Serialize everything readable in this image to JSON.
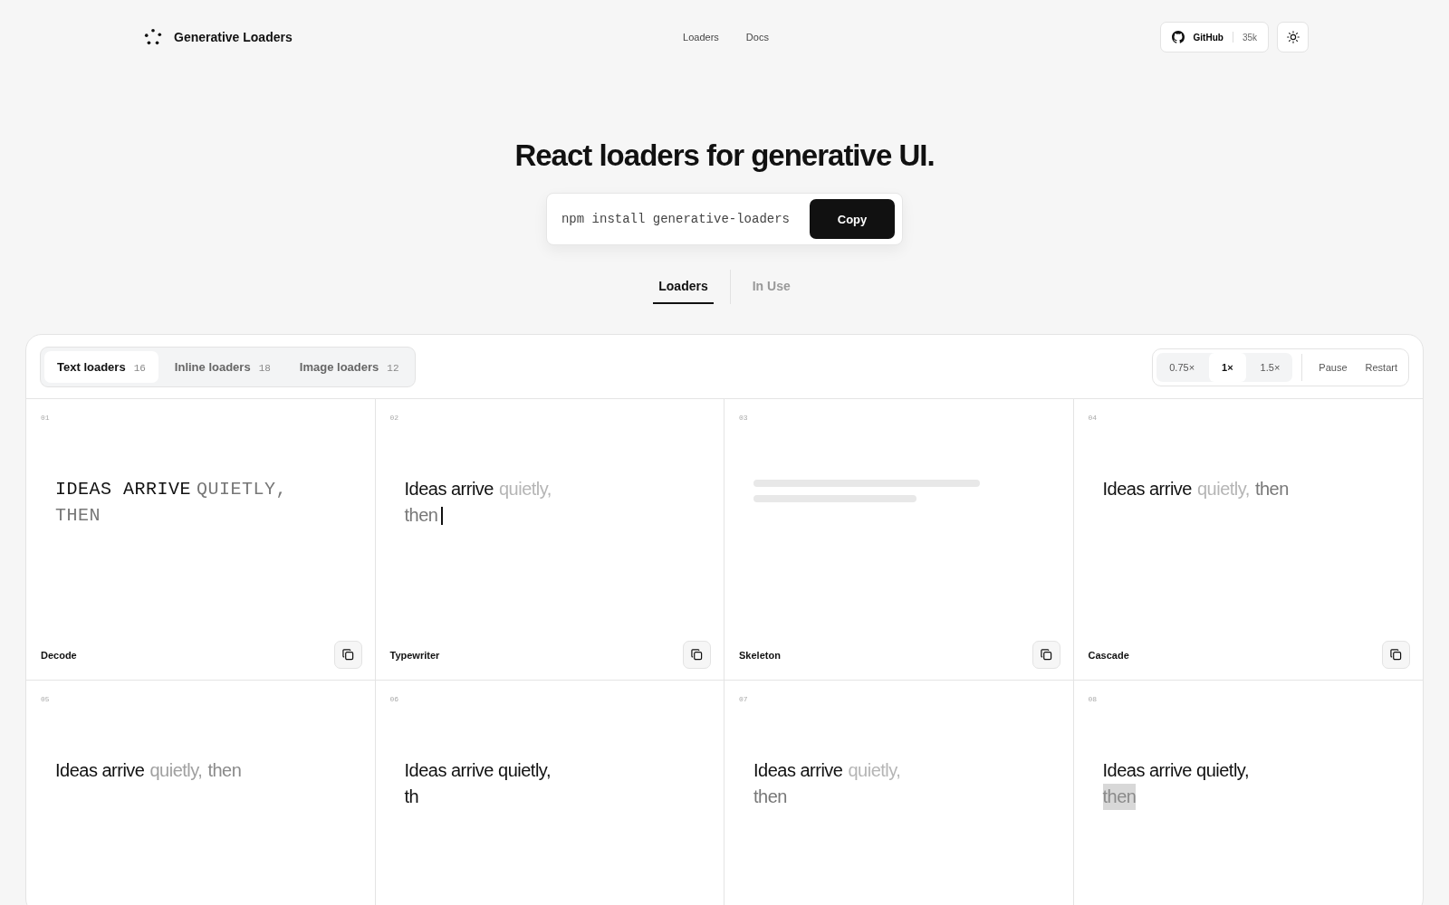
{
  "brand": {
    "name": "Generative Loaders"
  },
  "nav": [
    {
      "label": "Loaders"
    },
    {
      "label": "Docs"
    }
  ],
  "github": {
    "label": "GitHub",
    "count": "35k"
  },
  "hero": {
    "title": "React loaders for generative UI.",
    "command": "npm install generative-loaders",
    "copy_label": "Copy"
  },
  "view_tabs": [
    {
      "label": "Loaders",
      "selected": true
    },
    {
      "label": "In Use",
      "selected": false
    }
  ],
  "category_tabs": [
    {
      "label": "Text loaders",
      "count": "16",
      "selected": true
    },
    {
      "label": "Inline loaders",
      "count": "18",
      "selected": false
    },
    {
      "label": "Image loaders",
      "count": "12",
      "selected": false
    }
  ],
  "speeds": [
    {
      "label": "0.75×",
      "selected": false
    },
    {
      "label": "1×",
      "selected": true
    },
    {
      "label": "1.5×",
      "selected": false
    }
  ],
  "playback": [
    {
      "label": "Pause"
    },
    {
      "label": "Restart"
    }
  ],
  "cards": [
    {
      "number": "01",
      "kind": "mono",
      "title": "Decode",
      "lines": [
        [
          {
            "text": "IDEAS ARRIVE",
            "color": "#111111",
            "highlighted": false
          },
          {
            "text": "QUIETLY,",
            "color": "#777777",
            "highlighted": false
          }
        ],
        [
          {
            "text": "THEN",
            "color": "#777777",
            "highlighted": false
          }
        ]
      ],
      "cursor": false
    },
    {
      "number": "02",
      "kind": "text",
      "title": "Typewriter",
      "lines": [
        [
          {
            "text": "Ideas arrive",
            "color": "#111111",
            "highlighted": false
          },
          {
            "text": "quietly,",
            "color": "#b5b5b5",
            "highlighted": false
          }
        ],
        [
          {
            "text": "then",
            "color": "#777777",
            "highlighted": false
          }
        ]
      ],
      "cursor": true
    },
    {
      "number": "03",
      "kind": "skeleton",
      "title": "Skeleton",
      "cursor": false
    },
    {
      "number": "04",
      "kind": "text",
      "title": "Cascade",
      "lines": [
        [
          {
            "text": "Ideas arrive",
            "color": "#111111",
            "highlighted": false
          },
          {
            "text": "quietly,",
            "color": "#b5b5b5",
            "highlighted": false
          },
          {
            "text": "then",
            "color": "#777777",
            "highlighted": false
          }
        ]
      ],
      "cursor": false
    },
    {
      "number": "05",
      "kind": "text",
      "lines": [
        [
          {
            "text": "Ideas arrive",
            "color": "#111111",
            "highlighted": false
          },
          {
            "text": "quietly,",
            "color": "#a0a0a0",
            "highlighted": false
          },
          {
            "text": "then",
            "color": "#8a8a8a",
            "highlighted": false
          }
        ]
      ],
      "cursor": false
    },
    {
      "number": "06",
      "kind": "text",
      "lines": [
        [
          {
            "text": "Ideas arrive quietly,",
            "color": "#111111",
            "highlighted": false
          }
        ],
        [
          {
            "text": "th",
            "color": "#111111",
            "highlighted": false
          }
        ]
      ],
      "cursor": false
    },
    {
      "number": "07",
      "kind": "text",
      "lines": [
        [
          {
            "text": "Ideas arrive",
            "color": "#111111",
            "highlighted": false
          },
          {
            "text": "quietly,",
            "color": "#b5b5b5",
            "highlighted": false
          }
        ],
        [
          {
            "text": "then",
            "color": "#777777",
            "highlighted": false
          }
        ]
      ],
      "cursor": false
    },
    {
      "number": "08",
      "kind": "text",
      "lines": [
        [
          {
            "text": "Ideas arrive quietly,",
            "color": "#111111",
            "highlighted": false
          }
        ],
        [
          {
            "text": "then",
            "color": "#8a8a8a",
            "highlighted": true
          }
        ]
      ],
      "cursor": false
    }
  ]
}
